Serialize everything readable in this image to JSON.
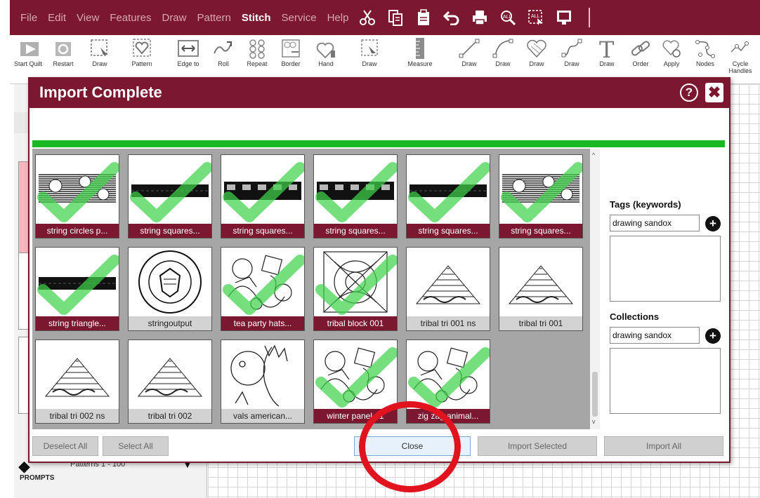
{
  "menu": {
    "items": [
      "File",
      "Edit",
      "View",
      "Features",
      "Draw",
      "Pattern",
      "Stitch",
      "Service",
      "Help"
    ],
    "active": "Stitch",
    "icons": [
      "cut-icon",
      "copy-icon",
      "paste-icon",
      "undo-icon",
      "print-icon",
      "zoom-icon",
      "select-all-icon",
      "screen-icon"
    ]
  },
  "toolbar": {
    "items": [
      "Start Quilt",
      "Restart",
      "Draw",
      "Pattern",
      "Edge to",
      "Roll",
      "Repeat",
      "Border",
      "Hand",
      "Draw",
      "Measure",
      "Draw",
      "Draw",
      "Draw",
      "Draw",
      "Draw",
      "Order",
      "Apply",
      "Nodes",
      "Cycle Handles"
    ]
  },
  "left_panel": {
    "patterns_text": "Patterns 1 - 100",
    "prompts": "PROMPTS"
  },
  "dialog": {
    "title": "Import Complete",
    "help": "?",
    "close_x": "✖",
    "progress": 1.0,
    "tiles": [
      {
        "label": "string circles p...",
        "checked": true,
        "art": "stripes"
      },
      {
        "label": "string squares...",
        "checked": true,
        "art": "bar"
      },
      {
        "label": "string squares...",
        "checked": true,
        "art": "blocks"
      },
      {
        "label": "string squares...",
        "checked": true,
        "art": "blocks"
      },
      {
        "label": "string squares...",
        "checked": true,
        "art": "bar"
      },
      {
        "label": "string squares...",
        "checked": true,
        "art": "stripes"
      },
      {
        "label": "string triangle...",
        "checked": true,
        "art": "bar"
      },
      {
        "label": "stringoutput",
        "checked": false,
        "art": "seal"
      },
      {
        "label": "tea party hats...",
        "checked": true,
        "art": "doodle"
      },
      {
        "label": "tribal block 001",
        "checked": true,
        "art": "tribal"
      },
      {
        "label": "tribal tri 001 ns",
        "checked": false,
        "art": "triangle"
      },
      {
        "label": "tribal tri 001",
        "checked": false,
        "art": "triangle"
      },
      {
        "label": "tribal tri 002 ns",
        "checked": false,
        "art": "triangle"
      },
      {
        "label": "tribal tri 002",
        "checked": false,
        "art": "triangle"
      },
      {
        "label": "vals american...",
        "checked": false,
        "art": "portrait"
      },
      {
        "label": "winter panel 01",
        "checked": true,
        "art": "doodle"
      },
      {
        "label": "zig zag animal...",
        "checked": true,
        "art": "doodle"
      }
    ],
    "tags": {
      "label": "Tags (keywords)",
      "value": "drawing sandox"
    },
    "collections": {
      "label": "Collections",
      "value": "drawing sandox"
    },
    "buttons": {
      "deselect_all": "Deselect All",
      "select_all": "Select All",
      "close": "Close",
      "import_selected": "Import Selected",
      "import_all": "Import All"
    }
  },
  "colors": {
    "brand": "#7b1830",
    "progress": "#19b923",
    "check": "#3fd24a",
    "annotation": "#e0131f"
  }
}
